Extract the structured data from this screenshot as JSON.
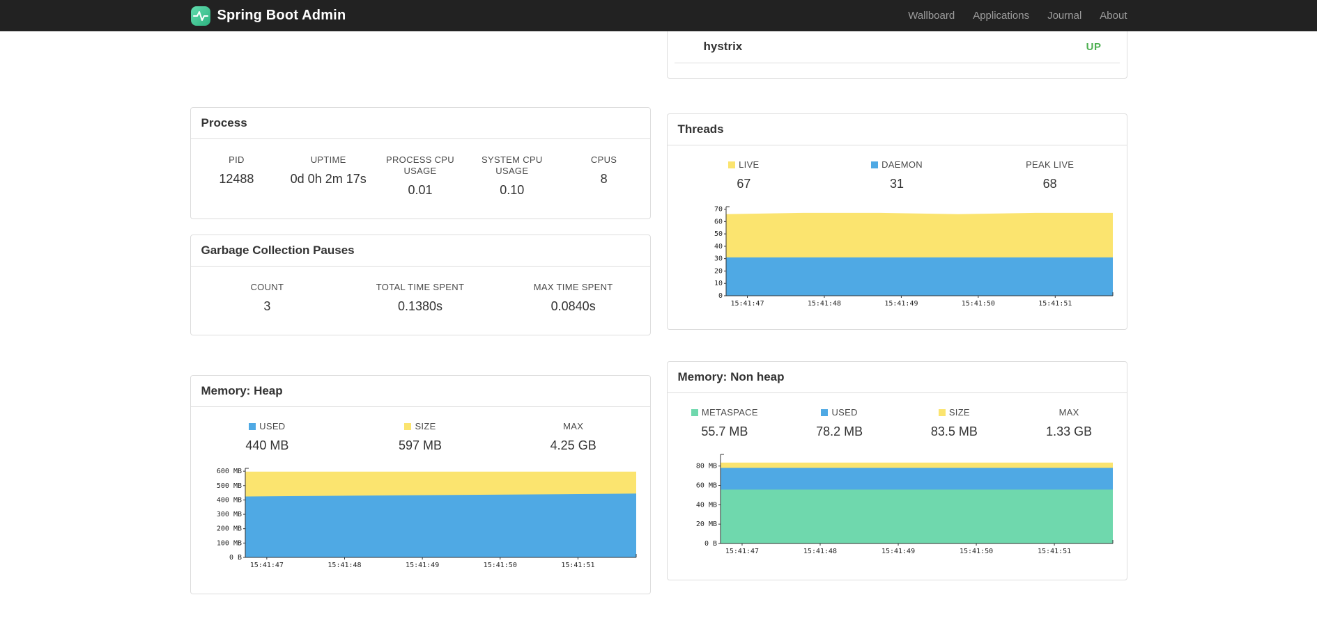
{
  "navbar": {
    "brand": "Spring Boot Admin",
    "items": [
      {
        "label": "Wallboard"
      },
      {
        "label": "Applications"
      },
      {
        "label": "Journal"
      },
      {
        "label": "About"
      }
    ]
  },
  "applications_panel": {
    "row": {
      "name": "hystrix",
      "status": "UP"
    }
  },
  "process": {
    "title": "Process",
    "stats": [
      {
        "label": "PID",
        "value": "12488"
      },
      {
        "label": "UPTIME",
        "value": "0d 0h 2m 17s"
      },
      {
        "label": "PROCESS CPU USAGE",
        "value": "0.01"
      },
      {
        "label": "SYSTEM CPU USAGE",
        "value": "0.10"
      },
      {
        "label": "CPUS",
        "value": "8"
      }
    ]
  },
  "gc": {
    "title": "Garbage Collection Pauses",
    "stats": [
      {
        "label": "COUNT",
        "value": "3"
      },
      {
        "label": "TOTAL TIME SPENT",
        "value": "0.1380s"
      },
      {
        "label": "MAX TIME SPENT",
        "value": "0.0840s"
      }
    ]
  },
  "threads": {
    "title": "Threads",
    "stats": [
      {
        "label": "LIVE",
        "value": "67",
        "swatch": "#fbe46f"
      },
      {
        "label": "DAEMON",
        "value": "31",
        "swatch": "#4fa9e4"
      },
      {
        "label": "PEAK LIVE",
        "value": "68"
      }
    ]
  },
  "memory_heap": {
    "title": "Memory: Heap",
    "stats": [
      {
        "label": "USED",
        "value": "440 MB",
        "swatch": "#4fa9e4"
      },
      {
        "label": "SIZE",
        "value": "597 MB",
        "swatch": "#fbe46f"
      },
      {
        "label": "MAX",
        "value": "4.25 GB"
      }
    ]
  },
  "memory_nonheap": {
    "title": "Memory: Non heap",
    "stats": [
      {
        "label": "METASPACE",
        "value": "55.7 MB",
        "swatch": "#6fd8ad"
      },
      {
        "label": "USED",
        "value": "78.2 MB",
        "swatch": "#4fa9e4"
      },
      {
        "label": "SIZE",
        "value": "83.5 MB",
        "swatch": "#fbe46f"
      },
      {
        "label": "MAX",
        "value": "1.33 GB"
      }
    ]
  },
  "colors": {
    "navbar_bg": "#222222",
    "brand_green": "#2fb582",
    "status_up": "#4caf50",
    "chart_blue": "#4fa9e4",
    "chart_yellow": "#fbe46f",
    "chart_green": "#6fd8ad",
    "panel_border": "#dddddd"
  },
  "chart_data": [
    {
      "id": "threads",
      "type": "area",
      "title": "Threads",
      "stacked": false,
      "grid": false,
      "x": [
        "15:41:47",
        "15:41:48",
        "15:41:49",
        "15:41:50",
        "15:41:51"
      ],
      "ylim": [
        0,
        72
      ],
      "yticks": [
        {
          "v": 0,
          "label": "0"
        },
        {
          "v": 10,
          "label": "10"
        },
        {
          "v": 20,
          "label": "20"
        },
        {
          "v": 30,
          "label": "30"
        },
        {
          "v": 40,
          "label": "40"
        },
        {
          "v": 50,
          "label": "50"
        },
        {
          "v": 60,
          "label": "60"
        },
        {
          "v": 70,
          "label": "70"
        }
      ],
      "series": [
        {
          "name": "LIVE",
          "color": "#fbe46f",
          "values": [
            66,
            67,
            67,
            66,
            67,
            67
          ]
        },
        {
          "name": "DAEMON",
          "color": "#4fa9e4",
          "values": [
            31,
            31,
            31,
            31,
            31,
            31
          ]
        }
      ]
    },
    {
      "id": "memory-heap",
      "type": "area",
      "title": "Memory: Heap",
      "stacked": false,
      "grid": false,
      "x": [
        "15:41:47",
        "15:41:48",
        "15:41:49",
        "15:41:50",
        "15:41:51"
      ],
      "ylim": [
        0,
        620
      ],
      "yticks": [
        {
          "v": 0,
          "label": "0 B"
        },
        {
          "v": 100,
          "label": "100 MB"
        },
        {
          "v": 200,
          "label": "200 MB"
        },
        {
          "v": 300,
          "label": "300 MB"
        },
        {
          "v": 400,
          "label": "400 MB"
        },
        {
          "v": 500,
          "label": "500 MB"
        },
        {
          "v": 600,
          "label": "600 MB"
        }
      ],
      "series": [
        {
          "name": "SIZE",
          "color": "#fbe46f",
          "values": [
            597,
            597,
            597,
            597,
            597,
            597
          ]
        },
        {
          "name": "USED",
          "color": "#4fa9e4",
          "values": [
            424,
            428,
            432,
            436,
            440,
            444
          ]
        }
      ]
    },
    {
      "id": "memory-nonheap",
      "type": "area",
      "title": "Memory: Non heap",
      "stacked": false,
      "grid": false,
      "x": [
        "15:41:47",
        "15:41:48",
        "15:41:49",
        "15:41:50",
        "15:41:51"
      ],
      "ylim": [
        0,
        92
      ],
      "yticks": [
        {
          "v": 0,
          "label": "0 B"
        },
        {
          "v": 20,
          "label": "20 MB"
        },
        {
          "v": 40,
          "label": "40 MB"
        },
        {
          "v": 60,
          "label": "60 MB"
        },
        {
          "v": 80,
          "label": "80 MB"
        }
      ],
      "series": [
        {
          "name": "SIZE",
          "color": "#fbe46f",
          "values": [
            83.5,
            83.5,
            83.5,
            83.5,
            83.5,
            83.5
          ]
        },
        {
          "name": "USED",
          "color": "#4fa9e4",
          "values": [
            78.2,
            78.2,
            78.2,
            78.2,
            78.2,
            78.2
          ]
        },
        {
          "name": "METASPACE",
          "color": "#6fd8ad",
          "values": [
            55.7,
            55.7,
            55.7,
            55.7,
            55.7,
            55.7
          ]
        }
      ]
    }
  ]
}
